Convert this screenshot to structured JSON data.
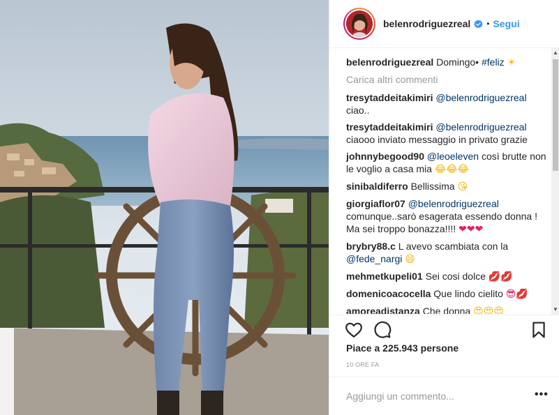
{
  "post": {
    "username": "belenrodriguezreal",
    "follow_label": "Segui",
    "separator": "•",
    "caption": {
      "user": "belenrodriguezreal",
      "text": "Domingo•",
      "hashtag": "#feliz",
      "emoji": "☀"
    },
    "load_more": "Carica altri commenti",
    "comments": [
      {
        "user": "tresytaddeitakimiri",
        "mention": "@belenrodriguezreal",
        "text": "ciao..",
        "emoji": ""
      },
      {
        "user": "tresytaddeitakimiri",
        "mention": "@belenrodriguezreal",
        "text": "ciaooo inviato messaggio in privato grazie",
        "emoji": ""
      },
      {
        "user": "johnnybegood90",
        "mention": "@leoeleven",
        "text": "così brutte non le voglio a casa mia",
        "emoji": "😂😂😂"
      },
      {
        "user": "sinibaldiferro",
        "mention": "",
        "text": "Bellissima",
        "emoji": "😘"
      },
      {
        "user": "giorgiaflor07",
        "mention": "@belenrodriguezreal",
        "text": "comunque..sarò esagerata essendo donna ! Ma sei troppo bonazza!!!!",
        "emoji": "❤❤❤"
      },
      {
        "user": "brybry88.c",
        "mention": "",
        "text": "L avevo scambiata con la",
        "mention2": "@fede_nargi",
        "emoji": "😄"
      },
      {
        "user": "mehmetkupeli01",
        "mention": "",
        "text": "Sei cosi dolce",
        "emoji": "💋💋"
      },
      {
        "user": "domenicoacocella",
        "mention": "",
        "text": "Que lindo cielito",
        "emoji": "😎💋"
      },
      {
        "user": "amoreadistanza",
        "mention": "",
        "text": "Che donna",
        "emoji": "😍😍😍"
      }
    ],
    "likes": "Piace a 225.943 persone",
    "time": "10 ORE FA",
    "add_comment_placeholder": "Aggiungi un commento...",
    "more_label": "•••"
  },
  "colors": {
    "link": "#3897f0",
    "mention": "#003569",
    "muted": "#999999"
  },
  "icons": {
    "verified": "verified-badge-icon",
    "like": "heart-icon",
    "comment": "speech-bubble-icon",
    "save": "bookmark-icon",
    "more": "more-options-icon"
  }
}
